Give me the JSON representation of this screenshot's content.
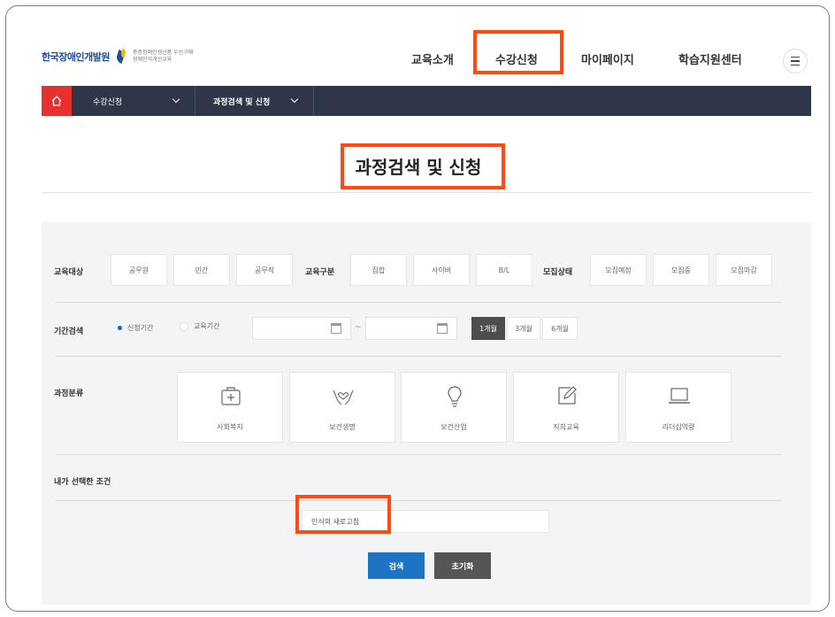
{
  "header": {
    "logo_text": "한국장애인개발원",
    "logo_sub_1": "중증장애인생산품 우선구매",
    "logo_sub_2": "장애인식개선교육",
    "nav": [
      "교육소개",
      "수강신청",
      "마이페이지",
      "학습지원센터"
    ]
  },
  "breadcrumb": {
    "items": [
      "수강신청",
      "과정검색 및 신청"
    ]
  },
  "page": {
    "title": "과정검색 및 신청"
  },
  "filters": {
    "target_label": "교육대상",
    "target_options": [
      "공무원",
      "민간",
      "공무직"
    ],
    "type_label": "교육구분",
    "type_options": [
      "집합",
      "사이버",
      "B/L"
    ],
    "status_label": "모집상태",
    "status_options": [
      "모집예정",
      "모집중",
      "모집마감"
    ],
    "period_label": "기간검색",
    "period_radio": [
      "신청기간",
      "교육기간"
    ],
    "period_selected": "신청기간",
    "date_from": "",
    "date_to": "",
    "date_separator": "~",
    "period_buttons": [
      "1개월",
      "3개월",
      "6개월"
    ],
    "period_active": "1개월",
    "category_label": "과정분류",
    "categories": [
      {
        "label": "사회복지",
        "icon": "first-aid-kit-icon"
      },
      {
        "label": "보건생명",
        "icon": "hands-heart-icon"
      },
      {
        "label": "보건산업",
        "icon": "lightbulb-icon"
      },
      {
        "label": "직희교육",
        "icon": "edit-note-icon"
      },
      {
        "label": "리더십역량",
        "icon": "laptop-icon"
      }
    ],
    "selected_label": "내가 선택한 조건",
    "selected_value": "인식의 새로고침"
  },
  "buttons": {
    "search": "검색",
    "reset": "초기화"
  },
  "colors": {
    "highlight": "#ff4a10",
    "breadcrumb_bg": "#2f3648",
    "home_bg": "#e8302f",
    "search_button": "#1d73c4",
    "reset_button": "#555555"
  }
}
